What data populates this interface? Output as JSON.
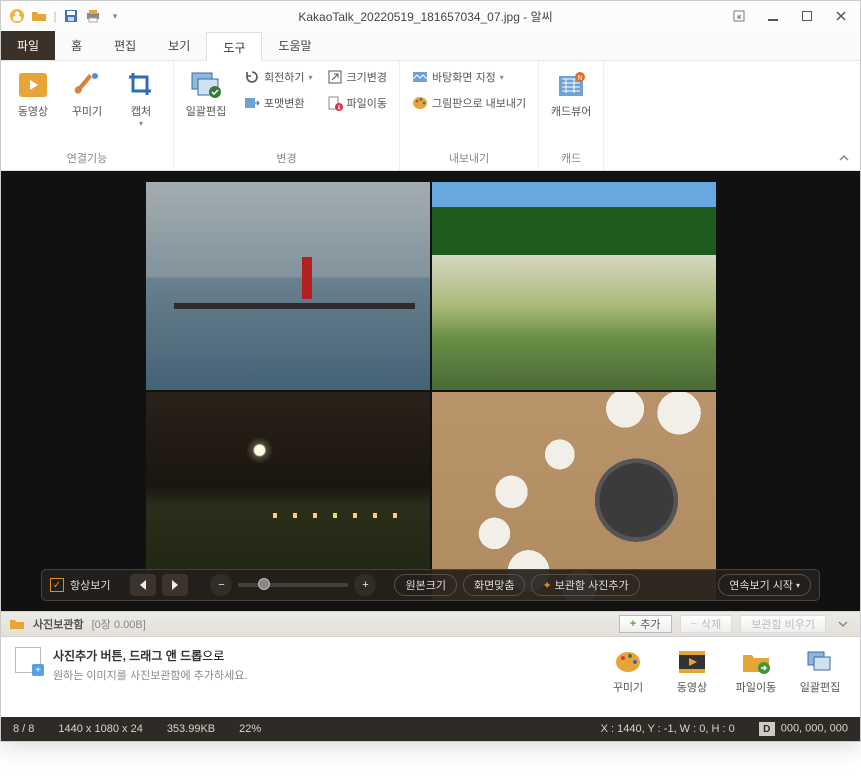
{
  "title": "KakaoTalk_20220519_181657034_07.jpg - 알씨",
  "menu": {
    "file": "파일",
    "home": "홈",
    "edit": "편집",
    "view": "보기",
    "tools": "도구",
    "help": "도움말"
  },
  "ribbon": {
    "groups": {
      "link": {
        "label": "연결기능",
        "video": "동영상",
        "decorate": "꾸미기",
        "capture": "캡처"
      },
      "change": {
        "label": "변경",
        "batch": "일괄편집",
        "rotate": "회전하기",
        "resize": "크기변경",
        "format": "포맷변환",
        "move": "파일이동"
      },
      "export": {
        "label": "내보내기",
        "wallpaper": "바탕화면 지정",
        "paint": "그림판으로 내보내기"
      },
      "cad": {
        "label": "캐드",
        "viewer": "캐드뷰어"
      }
    }
  },
  "viewer_bar": {
    "always_show": "항상보기",
    "original": "원본크기",
    "fit": "화면맞춤",
    "add_archive": "보관함 사진추가",
    "slideshow": "연속보기 시작"
  },
  "tray": {
    "label": "사진보관함",
    "count": "[0장 0.00B]",
    "add": "추가",
    "delete": "삭제",
    "clear": "보관함 비우기"
  },
  "helper": {
    "line1_bold": "사진추가 버튼, 드래그 앤 드롭",
    "line1_tail": "으로",
    "line2": "원하는 이미지를 사진보관함에 추가하세요.",
    "decorate": "꾸미기",
    "video": "동영상",
    "move": "파일이동",
    "batch": "일괄편집"
  },
  "status": {
    "page": "8 / 8",
    "dims": "1440 x 1080 x 24",
    "size": "353.99KB",
    "zoom": "22%",
    "coords": "X : 1440, Y : -1, W : 0, H : 0",
    "d_label": "D",
    "d_value": "000, 000, 000"
  }
}
